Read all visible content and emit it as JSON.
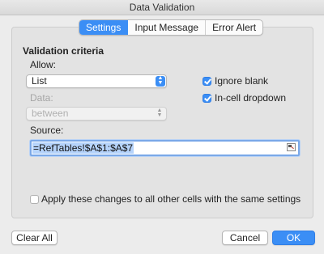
{
  "window": {
    "title": "Data Validation"
  },
  "tabs": [
    {
      "label": "Settings",
      "active": true
    },
    {
      "label": "Input Message",
      "active": false
    },
    {
      "label": "Error Alert",
      "active": false
    }
  ],
  "criteria": {
    "heading": "Validation criteria",
    "allow_label": "Allow:",
    "allow_value": "List",
    "data_label": "Data:",
    "data_value": "between",
    "ignore_blank_label": "Ignore blank",
    "ignore_blank_checked": true,
    "in_cell_dropdown_label": "In-cell dropdown",
    "in_cell_dropdown_checked": true,
    "source_label": "Source:",
    "source_value": "=RefTables!$A$1:$A$7"
  },
  "apply_all": {
    "label": "Apply these changes to all other cells with the same settings",
    "checked": false
  },
  "buttons": {
    "clear_all": "Clear All",
    "cancel": "Cancel",
    "ok": "OK"
  },
  "colors": {
    "accent": "#3b8ef5",
    "selection": "#b5d3fb"
  }
}
